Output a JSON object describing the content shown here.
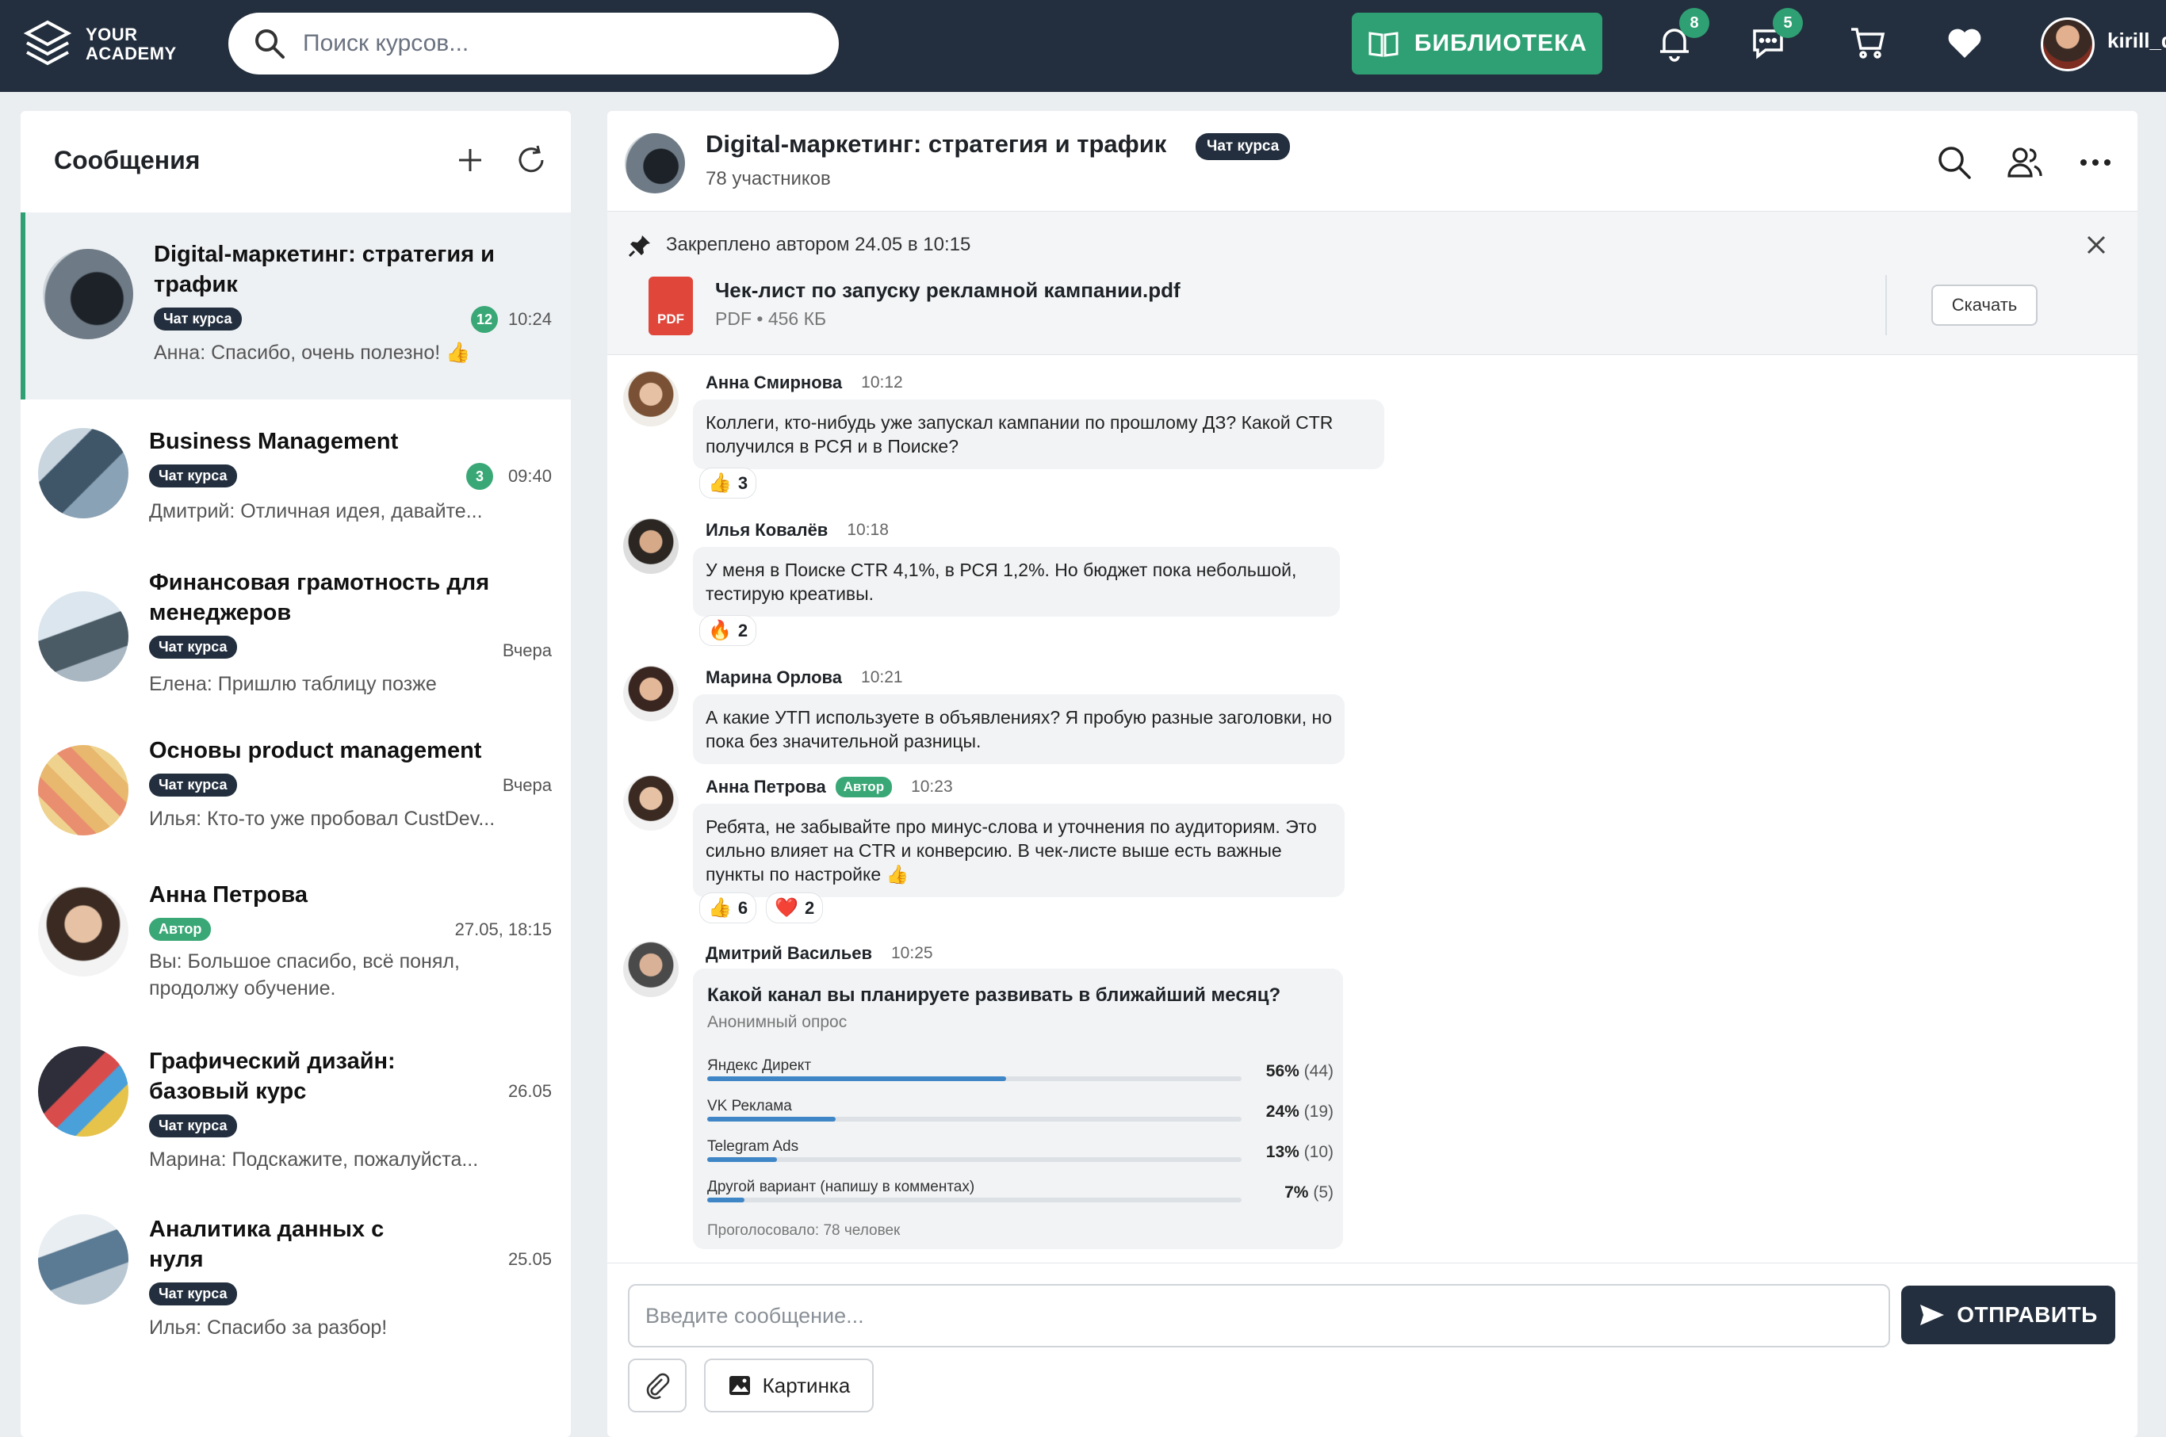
{
  "header": {
    "logo_line1": "YOUR",
    "logo_line2": "ACADEMY",
    "search_placeholder": "Поиск курсов...",
    "library_label": "БИБЛИОТЕКА",
    "notifications_count": "8",
    "messages_count": "5",
    "username": "kirill_d"
  },
  "sidebar": {
    "title": "Сообщения",
    "conversations": [
      {
        "name": "Digital-маркетинг: стратегия и трафик",
        "tag": "Чат курса",
        "unread": "12",
        "time": "10:24",
        "preview": "Анна: Спасибо, очень полезно! 👍"
      },
      {
        "name": "Business Management",
        "tag": "Чат курса",
        "unread": "3",
        "time": "09:40",
        "preview": "Дмитрий: Отличная идея, давайте..."
      },
      {
        "name": "Финансовая грамотность для менеджеров",
        "tag": "Чат курса",
        "time": "Вчера",
        "preview": "Елена: Пришлю таблицу позже"
      },
      {
        "name": "Основы product management",
        "tag": "Чат курса",
        "time": "Вчера",
        "preview": "Илья: Кто-то уже пробовал CustDev..."
      },
      {
        "name": "Анна Петрова",
        "tag": "Автор",
        "time": "27.05, 18:15",
        "preview": "Вы: Большое спасибо, всё понял, продолжу обучение."
      },
      {
        "name": "Графический дизайн: базовый курс",
        "tag": "Чат курса",
        "time": "26.05",
        "preview": "Марина: Подскажите, пожалуйста..."
      },
      {
        "name": "Аналитика данных с нуля",
        "tag": "Чат курса",
        "time": "25.05",
        "preview": "Илья: Спасибо за разбор!"
      }
    ]
  },
  "chat": {
    "title": "Digital-маркетинг: стратегия и трафик",
    "tag": "Чат курса",
    "members": "78 участников",
    "pinned": {
      "label": "Закреплено автором 24.05 в 10:15",
      "file_name": "Чек-лист по запуску рекламной кампании.pdf",
      "file_meta": "PDF • 456 КБ",
      "file_type": "PDF",
      "download_label": "Скачать"
    },
    "messages": [
      {
        "author": "Анна Смирнова",
        "time": "10:12",
        "text": "Коллеги, кто-нибудь уже запускал кампании по прошлому ДЗ? Какой CTR получился в РСЯ и в Поиске?",
        "reactions": [
          {
            "emoji": "👍",
            "count": "3"
          }
        ]
      },
      {
        "author": "Илья Ковалёв",
        "time": "10:18",
        "text": "У меня в Поиске CTR 4,1%, в РСЯ 1,2%. Но бюджет пока небольшой, тестирую креативы.",
        "reactions": [
          {
            "emoji": "🔥",
            "count": "2"
          }
        ]
      },
      {
        "author": "Марина Орлова",
        "time": "10:21",
        "text": "А какие УТП используете в объявлениях? Я пробую разные заголовки, но пока без значительной разницы.",
        "reactions": []
      },
      {
        "author": "Анна Петрова",
        "author_tag": "Автор",
        "time": "10:23",
        "text": "Ребята, не забывайте про минус-слова и уточнения по аудиториям. Это сильно влияет на CTR и конверсию. В чек-листе выше есть важные пункты по настройке 👍",
        "reactions": [
          {
            "emoji": "👍",
            "count": "6"
          },
          {
            "emoji": "❤️",
            "count": "2"
          }
        ]
      },
      {
        "author": "Дмитрий Васильев",
        "time": "10:25"
      }
    ],
    "poll": {
      "question": "Какой канал вы планируете развивать в ближайший месяц?",
      "subtitle": "Анонимный опрос",
      "options": [
        {
          "label": "Яндекс Директ",
          "percent": "56%",
          "votes": "(44)",
          "share": 0.56
        },
        {
          "label": "VK Реклама",
          "percent": "24%",
          "votes": "(19)",
          "share": 0.24
        },
        {
          "label": "Telegram Ads",
          "percent": "13%",
          "votes": "(10)",
          "share": 0.13
        },
        {
          "label": "Другой вариант (напишу в комментах)",
          "percent": "7%",
          "votes": "(5)",
          "share": 0.07
        }
      ],
      "footer": "Проголосовало: 78 человек"
    },
    "composer": {
      "placeholder": "Введите сообщение...",
      "send_label": "ОТПРАВИТЬ",
      "image_label": "Картинка"
    }
  },
  "colors": {
    "accent": "#2fa073",
    "dark": "#232f3e",
    "poll_bar": "#3f86c7"
  }
}
